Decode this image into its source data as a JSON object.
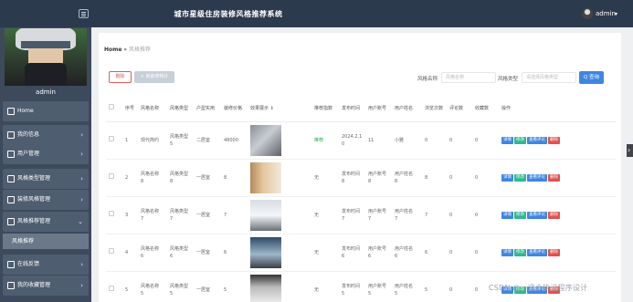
{
  "header": {
    "app_title": "城市星级住房装修风格推荐系统",
    "user_name": "admin",
    "caret": "▾"
  },
  "sidebar": {
    "user_name": "admin",
    "items": [
      {
        "label": "Home",
        "arrow": "",
        "icon": "home-icon"
      },
      {
        "label": "我的信息",
        "arrow": "›",
        "icon": "user-info-icon"
      },
      {
        "label": "用户管理",
        "arrow": "›",
        "icon": "users-icon"
      },
      {
        "label": "风格类型管理",
        "arrow": "›",
        "icon": "category-icon"
      },
      {
        "label": "装修风格管理",
        "arrow": "›",
        "icon": "style-icon"
      },
      {
        "label": "风格推荐管理",
        "arrow": "⌄",
        "icon": "recommend-icon"
      },
      {
        "label": "在线反馈",
        "arrow": "›",
        "icon": "feedback-icon"
      },
      {
        "label": "我的收藏管理",
        "arrow": "›",
        "icon": "favorite-icon"
      }
    ],
    "sub_item": "风格推荐"
  },
  "breadcrumb": {
    "home": "Home",
    "sep": "»",
    "current": "风格推荐"
  },
  "toolbar": {
    "delete_label": "删除",
    "stats_label": "< 房装修统计",
    "search_label": "风格名称",
    "search_placeholder": "风格名称",
    "type_label": "风格类型",
    "type_placeholder": "请选择风格类型",
    "search_button": "Q 查询"
  },
  "table": {
    "columns": [
      "",
      "序号",
      "风格名称",
      "风格类型",
      "户型实用",
      "装修价格",
      "效果展示 ⇕",
      "推荐指数",
      "发布时间",
      "用户账号",
      "用户姓名",
      "浏览次数",
      "评论数",
      "收藏数",
      "操作"
    ],
    "actions": [
      "详情",
      "修改",
      "查看评论",
      "删除"
    ],
    "rows": [
      {
        "cb": "",
        "no": "1",
        "name": "现代简约",
        "type": "风格类型\n5",
        "layout": "二居室",
        "price": "48000",
        "rec": "推荐",
        "time": "2024.2.1\n0",
        "account": "11",
        "uname": "小雅",
        "views": "0",
        "comments": "0",
        "favs": "0"
      },
      {
        "cb": "",
        "no": "2",
        "name": "风格名称\n8",
        "type": "风格类型\n8",
        "layout": "一居室",
        "price": "8",
        "rec": "无",
        "time": "发布时间\n8",
        "account": "用户账号\n8",
        "uname": "用户姓名\n8",
        "views": "8",
        "comments": "0",
        "favs": "0"
      },
      {
        "cb": "",
        "no": "3",
        "name": "风格名称\n7",
        "type": "风格类型\n7",
        "layout": "一居室",
        "price": "7",
        "rec": "无",
        "time": "发布时间\n7",
        "account": "用户账号\n7",
        "uname": "用户姓名\n7",
        "views": "7",
        "comments": "0",
        "favs": "0"
      },
      {
        "cb": "",
        "no": "4",
        "name": "风格名称\n6",
        "type": "风格类型\n6",
        "layout": "一居室",
        "price": "6",
        "rec": "无",
        "time": "发布时间\n6",
        "account": "用户账号\n6",
        "uname": "用户姓名\n6",
        "views": "6",
        "comments": "0",
        "favs": "0"
      },
      {
        "cb": "",
        "no": "5",
        "name": "风格名称\n5",
        "type": "风格类型\n5",
        "layout": "一居室",
        "price": "5",
        "rec": "无",
        "time": "发布时间\n5",
        "account": "用户账号\n5",
        "uname": "用户姓名\n5",
        "views": "5",
        "comments": "0",
        "favs": "0"
      }
    ]
  },
  "watermark": "CSDN @一这个毕设程序设计",
  "colors": {
    "topbar": "#2c3a4e",
    "sidebar": "#3c4a5c",
    "accent_blue": "#3f86e0",
    "delete_red": "#e0524f",
    "edit_green": "#2fb892"
  }
}
